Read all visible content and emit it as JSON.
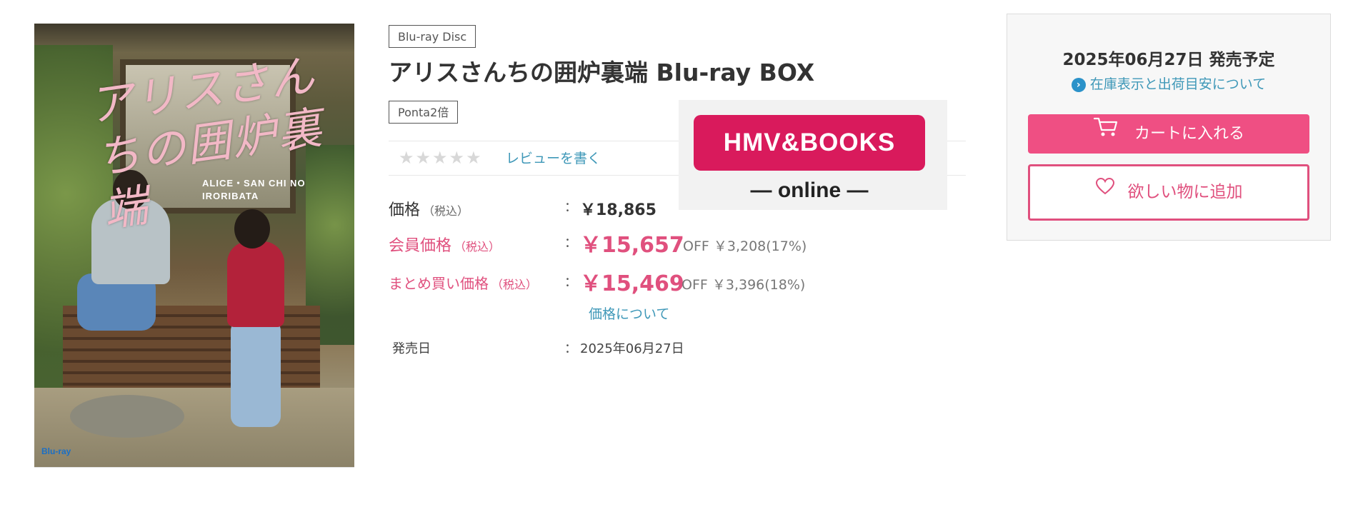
{
  "product": {
    "cover_image": {
      "title_jp": "アリスさんちの囲炉裏端",
      "title_en_line1": "ALICE・SAN CHI NO",
      "title_en_line2": "IRORIBATA",
      "bluray_mark": "Blu-ray"
    },
    "format_tag": "Blu-ray Disc",
    "title": "アリスさんちの囲炉裏端 Blu-ray BOX",
    "ponta_tag": "Ponta2倍",
    "rating_stars": "★★★★★",
    "review_link": "レビューを書く"
  },
  "pricing": {
    "colon": "：",
    "regular": {
      "label": "価格",
      "tax_note": "（税込）",
      "value": "￥18,865"
    },
    "member": {
      "label": "会員価格",
      "tax_note": "（税込）",
      "value": "￥15,657",
      "off": "OFF ￥3,208(17%)"
    },
    "bulk": {
      "label": "まとめ買い価格",
      "tax_note": "（税込）",
      "value": "￥15,469",
      "off": "OFF ￥3,396(18%)"
    },
    "about_link": "価格について"
  },
  "release": {
    "label": "発売日",
    "value": "2025年06月27日"
  },
  "logo": {
    "main": "HMV&BOOKS",
    "sub": "— online —"
  },
  "purchase_panel": {
    "release_plan": "2025年06月27日 発売予定",
    "stock_info_icon": "chevron-right-icon",
    "stock_info_link": "在庫表示と出荷目安について",
    "cart_button": "カートに入れる",
    "wishlist_button": "欲しい物に追加"
  },
  "colors": {
    "accent_pink": "#e0507e",
    "cart_pink": "#ef4f83",
    "link_blue": "#3f98b8",
    "logo_red": "#d91a5c"
  }
}
